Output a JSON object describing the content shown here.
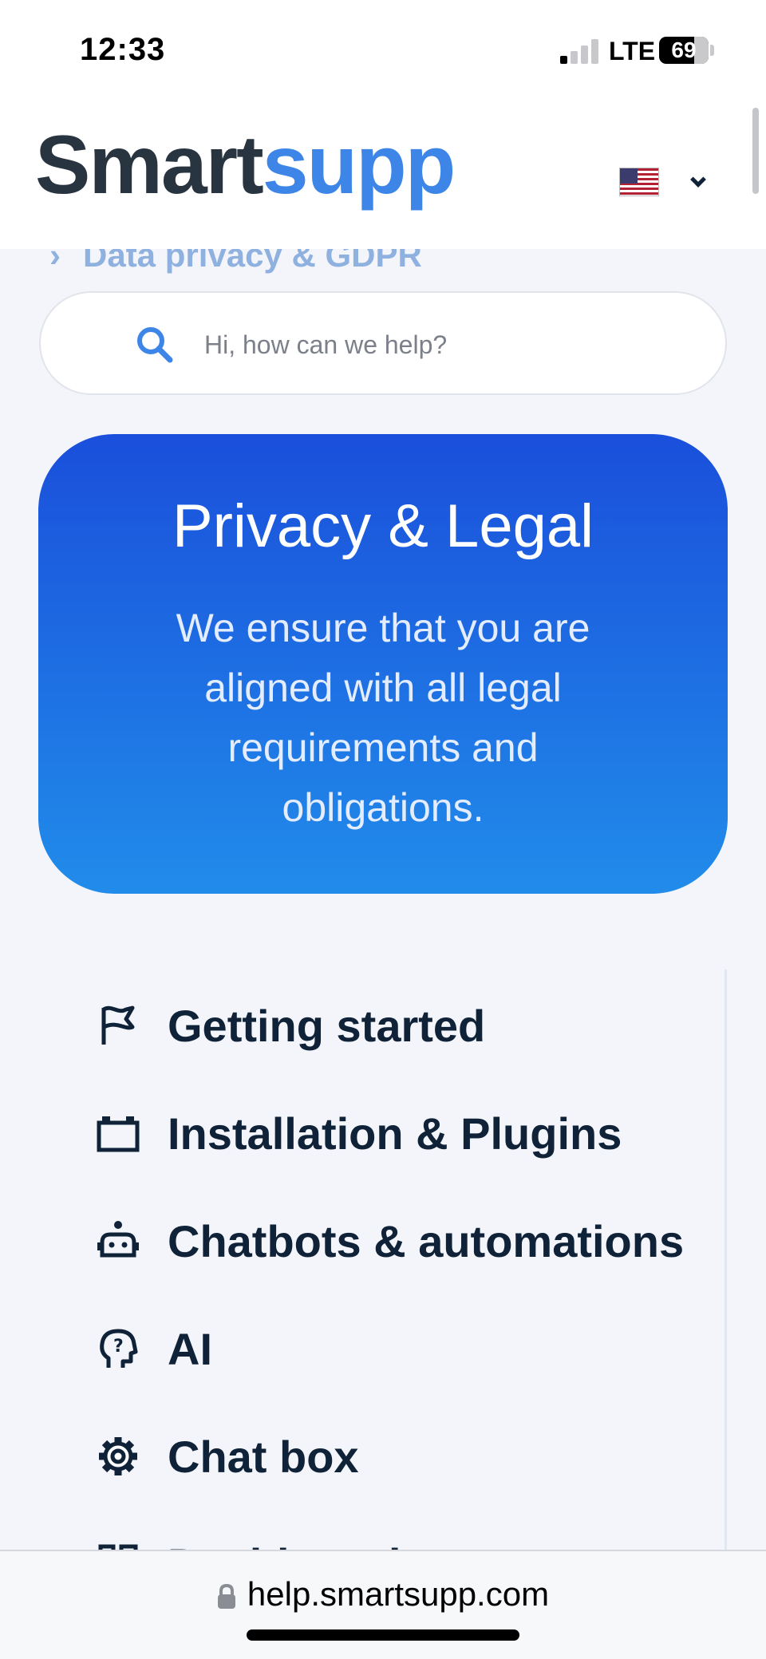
{
  "status_bar": {
    "time": "12:33",
    "network": "LTE",
    "battery": "69"
  },
  "header": {
    "logo_part1": "Smart",
    "logo_part2": "supp",
    "language": "us-flag",
    "language_dropdown_icon": "chevron-down-icon"
  },
  "breadcrumb": {
    "text": "Data privacy & GDPR",
    "icon": "chevron-right-icon"
  },
  "search": {
    "placeholder": "Hi, how can we help?",
    "value": "",
    "icon": "search-icon"
  },
  "hero": {
    "title": "Privacy & Legal",
    "description": "We ensure that you are aligned with all legal requirements and obligations."
  },
  "categories": [
    {
      "label": "Getting started",
      "icon": "flag-icon"
    },
    {
      "label": "Installation & Plugins",
      "icon": "plugin-icon"
    },
    {
      "label": "Chatbots & automations",
      "icon": "robot-icon"
    },
    {
      "label": "AI",
      "icon": "ai-head-icon"
    },
    {
      "label": "Chat box",
      "icon": "gear-icon"
    },
    {
      "label": "Dashboard",
      "icon": "dashboard-icon"
    }
  ],
  "browser": {
    "url": "help.smartsupp.com",
    "lock_icon": "lock-icon"
  },
  "colors": {
    "brand_dark": "#283440",
    "brand_blue": "#3d86e8",
    "hero_gradient_top": "#1a4fdb",
    "hero_gradient_bottom": "#218cea",
    "text_dark": "#0f2238"
  }
}
